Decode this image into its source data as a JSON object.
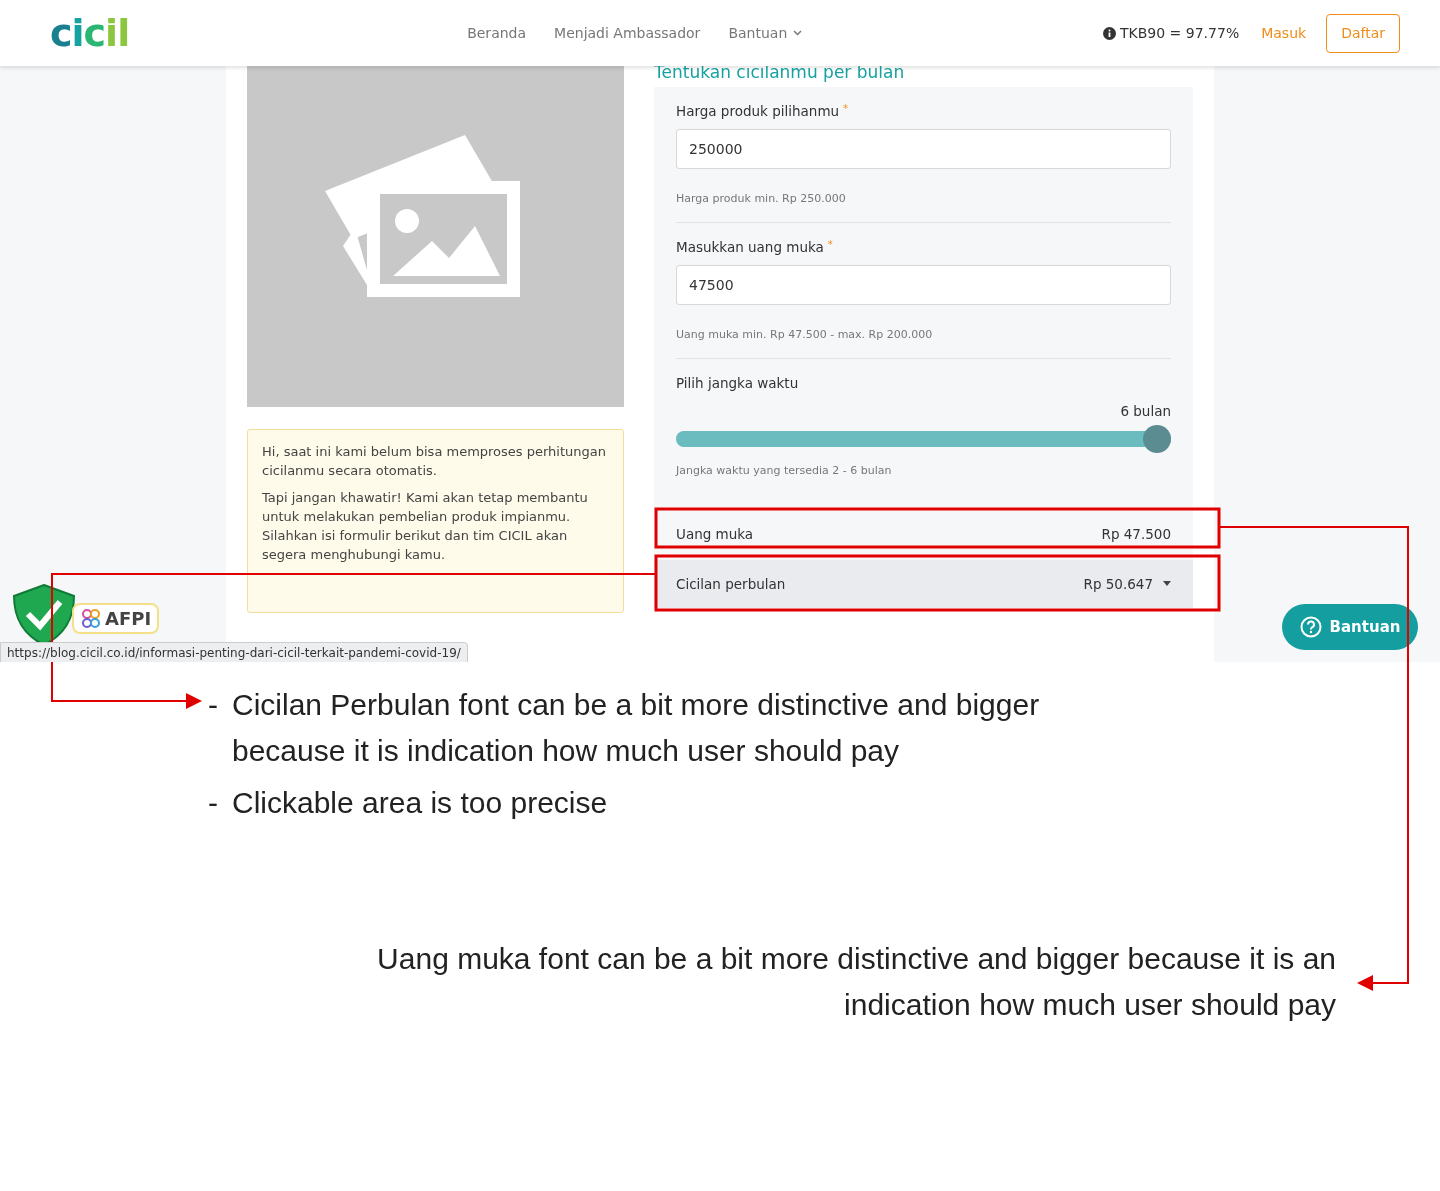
{
  "navbar": {
    "logo": "cicil",
    "links": [
      {
        "label": "Beranda",
        "has_caret": false
      },
      {
        "label": "Menjadi Ambassador",
        "has_caret": false
      },
      {
        "label": "Bantuan",
        "has_caret": true
      }
    ],
    "tkb": "TKB90 = 97.77%",
    "login": "Masuk",
    "register": "Daftar"
  },
  "product": {
    "image": {
      "kind": "picture"
    },
    "notice": [
      "Hi, saat ini kami belum bisa memproses perhitungan cicilanmu secara otomatis.",
      "Tapi jangan khawatir! Kami akan tetap membantu untuk melakukan pembelian produk impianmu. Silahkan isi formulir berikut dan tim CICIL akan segera menghubungi kamu."
    ]
  },
  "calculator": {
    "title": "Tentukan cicilanmu per bulan",
    "fields": [
      {
        "label": "Harga produk pilihanmu",
        "required_mark": "*",
        "value": "250000",
        "hint": "Harga produk min. Rp 250.000"
      },
      {
        "label": "Masukkan uang muka",
        "required_mark": "*",
        "value": "47500",
        "hint": "Uang muka min. Rp 47.500 - max. Rp 200.000"
      }
    ],
    "term": {
      "label": "Pilih jangka waktu",
      "reading": "6 bulan",
      "level": 1,
      "hint": "Jangka waktu yang tersedia 2 - 6 bulan"
    },
    "summary": [
      {
        "label": "Uang muka",
        "value": "Rp 47.500",
        "has_caret": false,
        "highlighted": false
      },
      {
        "label": "Cicilan perbulan",
        "value": "Rp 50.647",
        "has_caret": true,
        "highlighted": true
      }
    ]
  },
  "badges": {
    "afpi": "AFPI"
  },
  "status_url": "https://blog.cicil.co.id/informasi-penting-dari-cicil-terkait-pandemi-covid-19/",
  "help_button": "Bantuan",
  "annotations": {
    "bullets": [
      {
        "marker": "-",
        "text": "Cicilan Perbulan font can be a bit more distinctive and bigger because it is indication how much user should pay"
      },
      {
        "marker": "-",
        "text": "Clickable area is too precise"
      }
    ],
    "right_note": "Uang muka font can be a bit more distinctive and bigger because it is an indication how much user should pay"
  }
}
